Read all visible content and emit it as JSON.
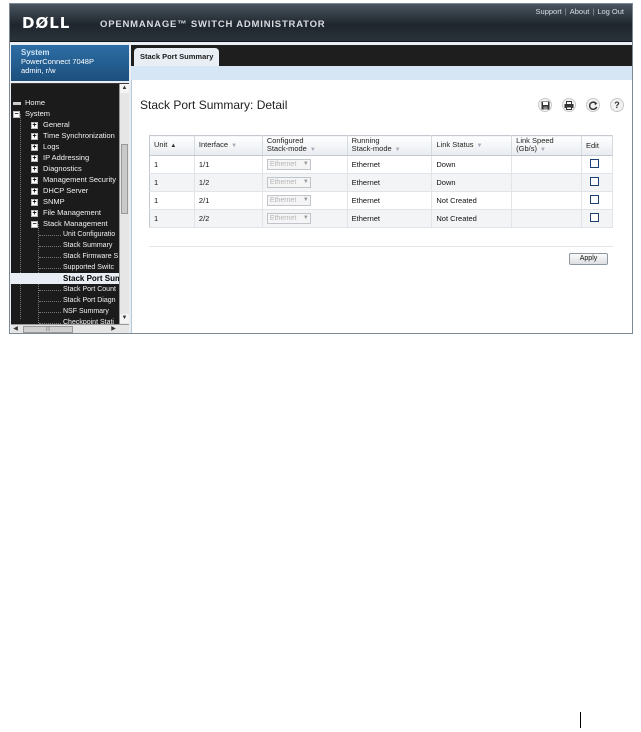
{
  "header": {
    "logo": "DØLL",
    "product": "OPENMANAGE™ SWITCH ADMINISTRATOR",
    "links": [
      "Support",
      "About",
      "Log Out"
    ],
    "separator": "|"
  },
  "system_box": {
    "title": "System",
    "device": "PowerConnect 7048P",
    "user": "admin, r/w"
  },
  "nav": {
    "items": [
      {
        "label": "Home",
        "expander": ""
      },
      {
        "label": "System",
        "expander": "−"
      },
      {
        "label": "General",
        "expander": "+"
      },
      {
        "label": "Time Synchronization",
        "expander": "+"
      },
      {
        "label": "Logs",
        "expander": "+"
      },
      {
        "label": "IP Addressing",
        "expander": "+"
      },
      {
        "label": "Diagnostics",
        "expander": "+"
      },
      {
        "label": "Management Security",
        "expander": "+"
      },
      {
        "label": "DHCP Server",
        "expander": "+"
      },
      {
        "label": "SNMP",
        "expander": "+"
      },
      {
        "label": "File Management",
        "expander": "+"
      },
      {
        "label": "Stack Management",
        "expander": "−"
      },
      {
        "label": "Unit Configuratio",
        "expander": ""
      },
      {
        "label": "Stack Summary",
        "expander": ""
      },
      {
        "label": "Stack Firmware S",
        "expander": ""
      },
      {
        "label": "Supported Switc",
        "expander": ""
      },
      {
        "label": "Stack Port Sum",
        "expander": ""
      },
      {
        "label": "Stack Port Count",
        "expander": ""
      },
      {
        "label": "Stack Port Diagn",
        "expander": ""
      },
      {
        "label": "NSF Summary",
        "expander": ""
      },
      {
        "label": "Checkpoint Stati",
        "expander": ""
      },
      {
        "label": "",
        "expander": "+"
      }
    ]
  },
  "tab": {
    "label": "Stack Port Summary"
  },
  "page": {
    "title": "Stack Port Summary: Detail"
  },
  "toolbar": {
    "save_icon": "floppy-disk-icon",
    "print_icon": "printer-icon",
    "refresh_icon": "refresh-icon",
    "help_icon": "help-icon"
  },
  "table": {
    "columns": [
      {
        "label": "Unit",
        "sort": "▲"
      },
      {
        "label": "Interface",
        "sort": "▼"
      },
      {
        "label": "Configured\nStack-mode",
        "sort": "▼"
      },
      {
        "label": "Running\nStack-mode",
        "sort": "▼"
      },
      {
        "label": "Link Status",
        "sort": "▼"
      },
      {
        "label": "Link Speed\n(Gb/s)",
        "sort": "▼"
      },
      {
        "label": "Edit",
        "sort": ""
      }
    ],
    "rows": [
      {
        "unit": "1",
        "interface": "1/1",
        "configured": "Ethernet",
        "running": "Ethernet",
        "status": "Down",
        "speed": ""
      },
      {
        "unit": "1",
        "interface": "1/2",
        "configured": "Ethernet",
        "running": "Ethernet",
        "status": "Down",
        "speed": ""
      },
      {
        "unit": "1",
        "interface": "2/1",
        "configured": "Ethernet",
        "running": "Ethernet",
        "status": "Not Created",
        "speed": ""
      },
      {
        "unit": "1",
        "interface": "2/2",
        "configured": "Ethernet",
        "running": "Ethernet",
        "status": "Not Created",
        "speed": ""
      }
    ]
  },
  "apply_label": "Apply",
  "colors": {
    "header_dark": "#1f262d",
    "system_blue": "#1c4f7d",
    "nav_bg": "#1b1b1b",
    "tab_strip": "#d7e6f4"
  }
}
